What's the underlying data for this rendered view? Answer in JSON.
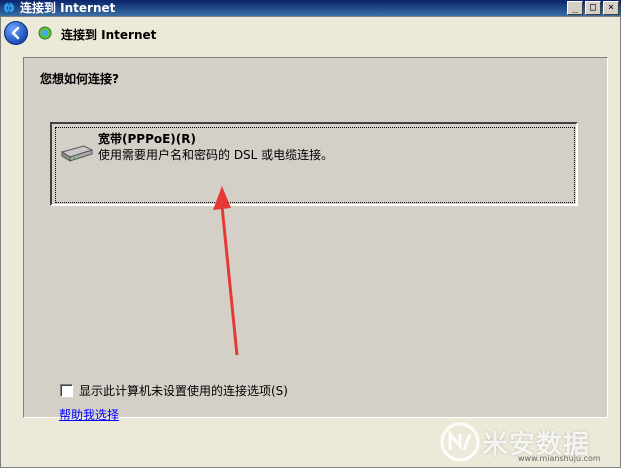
{
  "window": {
    "title": "连接到 Internet",
    "minimize": "_",
    "maximize": "□",
    "close": "×"
  },
  "nav": {
    "title": "连接到 Internet"
  },
  "content": {
    "question": "您想如何连接?",
    "option": {
      "title": "宽带(PPPoE)(R)",
      "description": "使用需要用户名和密码的 DSL 或电缆连接。"
    },
    "checkbox_label": "显示此计算机未设置使用的连接选项(S)",
    "help_link": "帮助我选择"
  },
  "watermark": {
    "text": "米安数据",
    "url": "www.mianshuju.com"
  },
  "colors": {
    "titlebar": "#0a246a",
    "annotation_arrow": "#e53935",
    "link": "#0000ff"
  }
}
